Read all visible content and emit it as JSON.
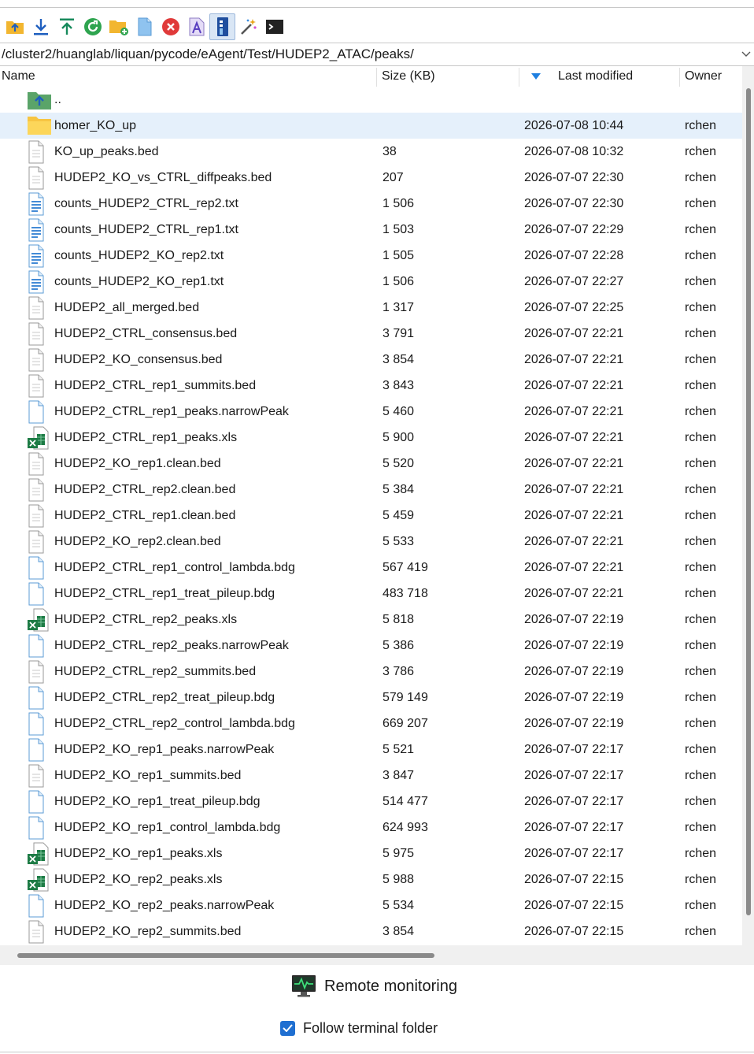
{
  "path": "/cluster2/huanglab/liquan/pycode/eAgent/Test/HUDEP2_ATAC/peaks/",
  "toolbar": {
    "icons": [
      "parent-folder-icon",
      "download-icon",
      "upload-icon",
      "refresh-icon",
      "new-folder-icon",
      "new-file-icon",
      "delete-icon",
      "rename-icon",
      "properties-icon",
      "magic-wand-icon",
      "terminal-icon"
    ]
  },
  "columns": {
    "name": "Name",
    "size": "Size (KB)",
    "modified": "Last modified",
    "owner": "Owner"
  },
  "colors": {
    "selection": "#e5f0fb",
    "folder": "#f7c542",
    "accent": "#1f6fd1",
    "excel": "#1d7b45"
  },
  "files": [
    {
      "name": "..",
      "size": "",
      "modified": "",
      "owner": "",
      "type": "parent"
    },
    {
      "name": "homer_KO_up",
      "size": "",
      "modified": "2026-07-08 10:44",
      "owner": "rchen",
      "type": "folder",
      "selected": true
    },
    {
      "name": "KO_up_peaks.bed",
      "size": "38",
      "modified": "2026-07-08 10:32",
      "owner": "rchen",
      "type": "generic"
    },
    {
      "name": "HUDEP2_KO_vs_CTRL_diffpeaks.bed",
      "size": "207",
      "modified": "2026-07-07 22:30",
      "owner": "rchen",
      "type": "generic"
    },
    {
      "name": "counts_HUDEP2_CTRL_rep2.txt",
      "size": "1 506",
      "modified": "2026-07-07 22:30",
      "owner": "rchen",
      "type": "text"
    },
    {
      "name": "counts_HUDEP2_CTRL_rep1.txt",
      "size": "1 503",
      "modified": "2026-07-07 22:29",
      "owner": "rchen",
      "type": "text"
    },
    {
      "name": "counts_HUDEP2_KO_rep2.txt",
      "size": "1 505",
      "modified": "2026-07-07 22:28",
      "owner": "rchen",
      "type": "text"
    },
    {
      "name": "counts_HUDEP2_KO_rep1.txt",
      "size": "1 506",
      "modified": "2026-07-07 22:27",
      "owner": "rchen",
      "type": "text"
    },
    {
      "name": "HUDEP2_all_merged.bed",
      "size": "1 317",
      "modified": "2026-07-07 22:25",
      "owner": "rchen",
      "type": "generic"
    },
    {
      "name": "HUDEP2_CTRL_consensus.bed",
      "size": "3 791",
      "modified": "2026-07-07 22:21",
      "owner": "rchen",
      "type": "generic"
    },
    {
      "name": "HUDEP2_KO_consensus.bed",
      "size": "3 854",
      "modified": "2026-07-07 22:21",
      "owner": "rchen",
      "type": "generic"
    },
    {
      "name": "HUDEP2_CTRL_rep1_summits.bed",
      "size": "3 843",
      "modified": "2026-07-07 22:21",
      "owner": "rchen",
      "type": "generic"
    },
    {
      "name": "HUDEP2_CTRL_rep1_peaks.narrowPeak",
      "size": "5 460",
      "modified": "2026-07-07 22:21",
      "owner": "rchen",
      "type": "blank"
    },
    {
      "name": "HUDEP2_CTRL_rep1_peaks.xls",
      "size": "5 900",
      "modified": "2026-07-07 22:21",
      "owner": "rchen",
      "type": "excel"
    },
    {
      "name": "HUDEP2_KO_rep1.clean.bed",
      "size": "5 520",
      "modified": "2026-07-07 22:21",
      "owner": "rchen",
      "type": "generic"
    },
    {
      "name": "HUDEP2_CTRL_rep2.clean.bed",
      "size": "5 384",
      "modified": "2026-07-07 22:21",
      "owner": "rchen",
      "type": "generic"
    },
    {
      "name": "HUDEP2_CTRL_rep1.clean.bed",
      "size": "5 459",
      "modified": "2026-07-07 22:21",
      "owner": "rchen",
      "type": "generic"
    },
    {
      "name": "HUDEP2_KO_rep2.clean.bed",
      "size": "5 533",
      "modified": "2026-07-07 22:21",
      "owner": "rchen",
      "type": "generic"
    },
    {
      "name": "HUDEP2_CTRL_rep1_control_lambda.bdg",
      "size": "567 419",
      "modified": "2026-07-07 22:21",
      "owner": "rchen",
      "type": "blank"
    },
    {
      "name": "HUDEP2_CTRL_rep1_treat_pileup.bdg",
      "size": "483 718",
      "modified": "2026-07-07 22:21",
      "owner": "rchen",
      "type": "blank"
    },
    {
      "name": "HUDEP2_CTRL_rep2_peaks.xls",
      "size": "5 818",
      "modified": "2026-07-07 22:19",
      "owner": "rchen",
      "type": "excel"
    },
    {
      "name": "HUDEP2_CTRL_rep2_peaks.narrowPeak",
      "size": "5 386",
      "modified": "2026-07-07 22:19",
      "owner": "rchen",
      "type": "blank"
    },
    {
      "name": "HUDEP2_CTRL_rep2_summits.bed",
      "size": "3 786",
      "modified": "2026-07-07 22:19",
      "owner": "rchen",
      "type": "generic"
    },
    {
      "name": "HUDEP2_CTRL_rep2_treat_pileup.bdg",
      "size": "579 149",
      "modified": "2026-07-07 22:19",
      "owner": "rchen",
      "type": "blank"
    },
    {
      "name": "HUDEP2_CTRL_rep2_control_lambda.bdg",
      "size": "669 207",
      "modified": "2026-07-07 22:19",
      "owner": "rchen",
      "type": "blank"
    },
    {
      "name": "HUDEP2_KO_rep1_peaks.narrowPeak",
      "size": "5 521",
      "modified": "2026-07-07 22:17",
      "owner": "rchen",
      "type": "blank"
    },
    {
      "name": "HUDEP2_KO_rep1_summits.bed",
      "size": "3 847",
      "modified": "2026-07-07 22:17",
      "owner": "rchen",
      "type": "generic"
    },
    {
      "name": "HUDEP2_KO_rep1_treat_pileup.bdg",
      "size": "514 477",
      "modified": "2026-07-07 22:17",
      "owner": "rchen",
      "type": "blank"
    },
    {
      "name": "HUDEP2_KO_rep1_control_lambda.bdg",
      "size": "624 993",
      "modified": "2026-07-07 22:17",
      "owner": "rchen",
      "type": "blank"
    },
    {
      "name": "HUDEP2_KO_rep1_peaks.xls",
      "size": "5 975",
      "modified": "2026-07-07 22:17",
      "owner": "rchen",
      "type": "excel"
    },
    {
      "name": "HUDEP2_KO_rep2_peaks.xls",
      "size": "5 988",
      "modified": "2026-07-07 22:15",
      "owner": "rchen",
      "type": "excel"
    },
    {
      "name": "HUDEP2_KO_rep2_peaks.narrowPeak",
      "size": "5 534",
      "modified": "2026-07-07 22:15",
      "owner": "rchen",
      "type": "blank"
    },
    {
      "name": "HUDEP2_KO_rep2_summits.bed",
      "size": "3 854",
      "modified": "2026-07-07 22:15",
      "owner": "rchen",
      "type": "generic"
    }
  ],
  "bottom": {
    "remote_monitoring": "Remote monitoring",
    "follow_terminal": "Follow terminal folder",
    "follow_checked": true
  }
}
